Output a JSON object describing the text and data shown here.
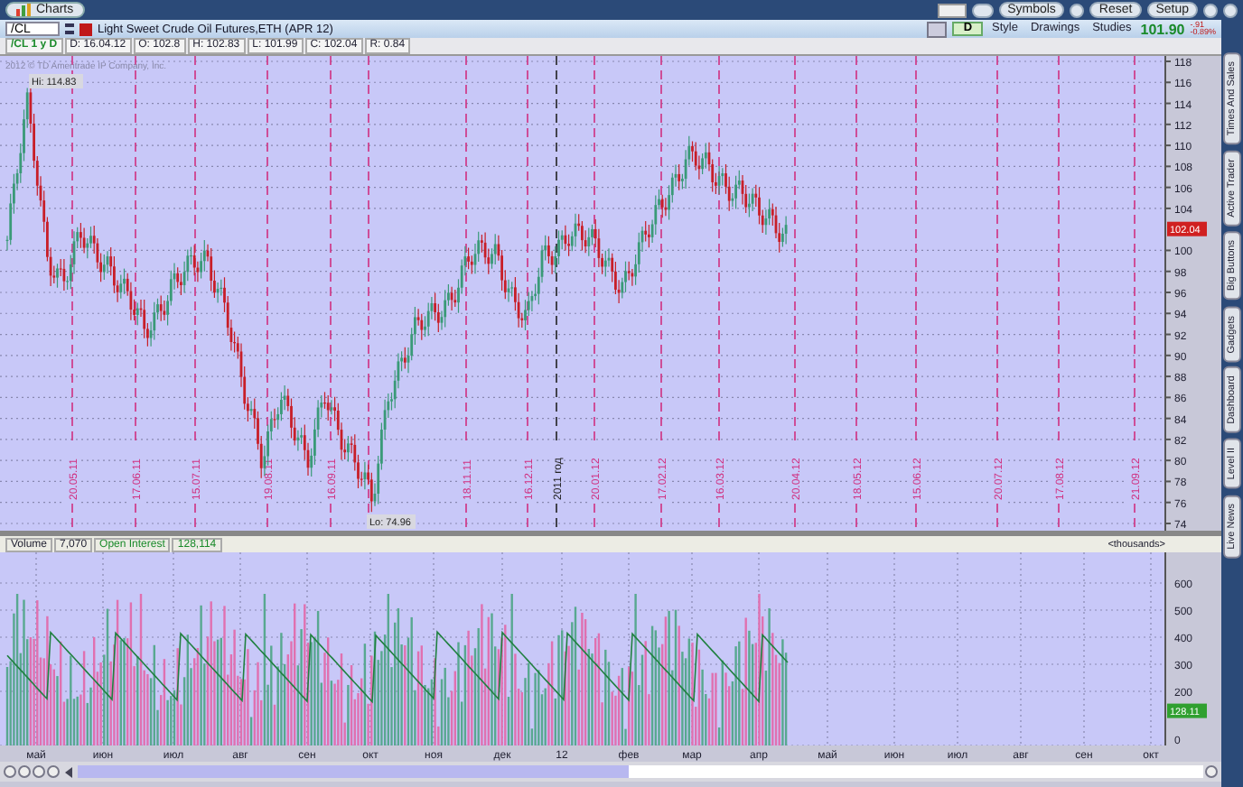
{
  "window": {
    "tab": "Charts"
  },
  "top_buttons": [
    "Symbols",
    "Reset",
    "Setup"
  ],
  "symbol": {
    "value": "/CL",
    "description": "Light Sweet Crude Oil Futures,ETH (APR 12)"
  },
  "toolbar": {
    "period": "D",
    "buttons": [
      "Style",
      "Drawings",
      "Studies"
    ],
    "last_price": "101.90",
    "change": "-.91",
    "change_percent": "-0.89%"
  },
  "info_bar": [
    "/CL 1 y D",
    "D: 16.04.12",
    "O: 102.8",
    "H: 102.83",
    "L: 101.99",
    "C: 102.04",
    "R: 0.84"
  ],
  "price_pane": {
    "copyright": "2012 © TD Ameritrade IP Company, Inc.",
    "high_label": "Hi: 114.83",
    "low_label": "Lo: 74.96",
    "price_tag": "102.04",
    "y_labels": [
      "118",
      "116",
      "114",
      "112",
      "110",
      "108",
      "106",
      "104",
      "100",
      "98",
      "96",
      "94",
      "92",
      "90",
      "88",
      "86",
      "84",
      "82",
      "80",
      "78",
      "76",
      "74"
    ],
    "date_labels": [
      {
        "text": "20.05.11",
        "kind": "date"
      },
      {
        "text": "17.06.11",
        "kind": "date"
      },
      {
        "text": "15.07.11",
        "kind": "date"
      },
      {
        "text": "19.08.11",
        "kind": "date"
      },
      {
        "text": "16.09.11",
        "kind": "date"
      },
      {
        "text": "18.11.11",
        "kind": "date"
      },
      {
        "text": "16.12.11",
        "kind": "date"
      },
      {
        "text": "2011 год",
        "kind": "year"
      },
      {
        "text": "20.01.12",
        "kind": "date"
      },
      {
        "text": "17.02.12",
        "kind": "date"
      },
      {
        "text": "16.03.12",
        "kind": "date"
      },
      {
        "text": "20.04.12",
        "kind": "date"
      },
      {
        "text": "18.05.12",
        "kind": "date"
      },
      {
        "text": "15.06.12",
        "kind": "date"
      },
      {
        "text": "20.07.12",
        "kind": "date"
      },
      {
        "text": "17.08.12",
        "kind": "date"
      },
      {
        "text": "21.09.12",
        "kind": "date"
      }
    ]
  },
  "volume_pane": {
    "labels": [
      {
        "text": "Volume",
        "kind": "name"
      },
      {
        "text": "7,070",
        "kind": "value"
      },
      {
        "text": "Open Interest",
        "kind": "oi"
      },
      {
        "text": "128,114",
        "kind": "oi"
      }
    ],
    "units": "<thousands>",
    "y_labels": [
      "600",
      "500",
      "400",
      "300",
      "200",
      "0"
    ],
    "oi_tag": "128.11"
  },
  "months": [
    "май",
    "июн",
    "июл",
    "авг",
    "сен",
    "окт",
    "ноя",
    "дек",
    "12",
    "фев",
    "мар",
    "апр",
    "май",
    "июн",
    "июл",
    "авг",
    "сен",
    "окт"
  ],
  "side_tabs": [
    "Times And Sales",
    "Active Trader",
    "Big Buttons",
    "Gadgets",
    "Dashboard",
    "Level II",
    "Live News"
  ]
}
